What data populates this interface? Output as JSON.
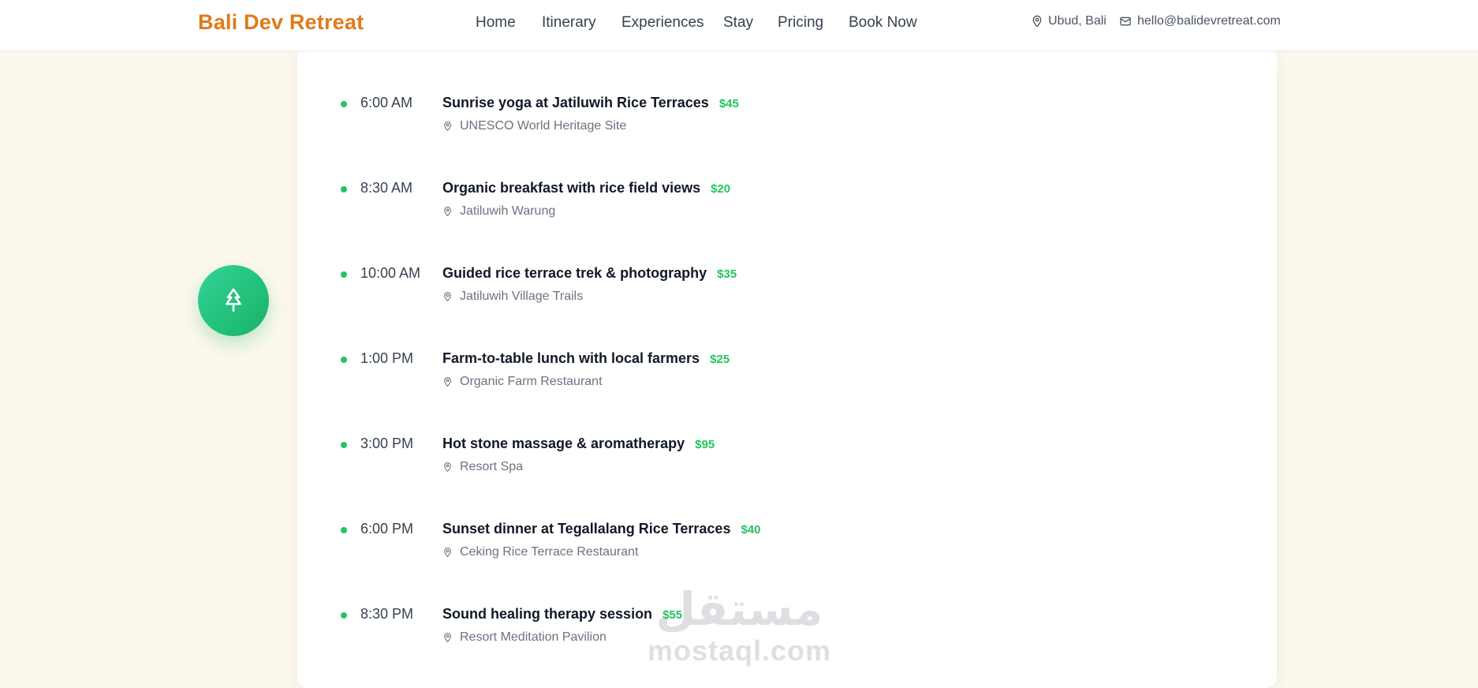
{
  "header": {
    "brand": "Bali Dev Retreat",
    "nav": [
      "Home",
      "Itinerary",
      "Experiences",
      "Stay",
      "Pricing",
      "Book Now"
    ],
    "location": "Ubud, Bali",
    "email": "hello@balidevretreat.com"
  },
  "schedule": [
    {
      "time": "6:00 AM",
      "title": "Sunrise yoga at Jatiluwih Rice Terraces",
      "price": "$45",
      "location": "UNESCO World Heritage Site"
    },
    {
      "time": "8:30 AM",
      "title": "Organic breakfast with rice field views",
      "price": "$20",
      "location": "Jatiluwih Warung"
    },
    {
      "time": "10:00 AM",
      "title": "Guided rice terrace trek & photography",
      "price": "$35",
      "location": "Jatiluwih Village Trails"
    },
    {
      "time": "1:00 PM",
      "title": "Farm-to-table lunch with local farmers",
      "price": "$25",
      "location": "Organic Farm Restaurant"
    },
    {
      "time": "3:00 PM",
      "title": "Hot stone massage & aromatherapy",
      "price": "$95",
      "location": "Resort Spa"
    },
    {
      "time": "6:00 PM",
      "title": "Sunset dinner at Tegallalang Rice Terraces",
      "price": "$40",
      "location": "Ceking Rice Terrace Restaurant"
    },
    {
      "time": "8:30 PM",
      "title": "Sound healing therapy session",
      "price": "$55",
      "location": "Resort Meditation Pavilion"
    }
  ],
  "fab_icon": "tree-icon",
  "watermark": {
    "arabic": "مستقل",
    "latin": "mostaql.com"
  },
  "colors": {
    "brand": "#e07a1a",
    "accent": "#22c55e",
    "background": "#fdf8ee"
  }
}
